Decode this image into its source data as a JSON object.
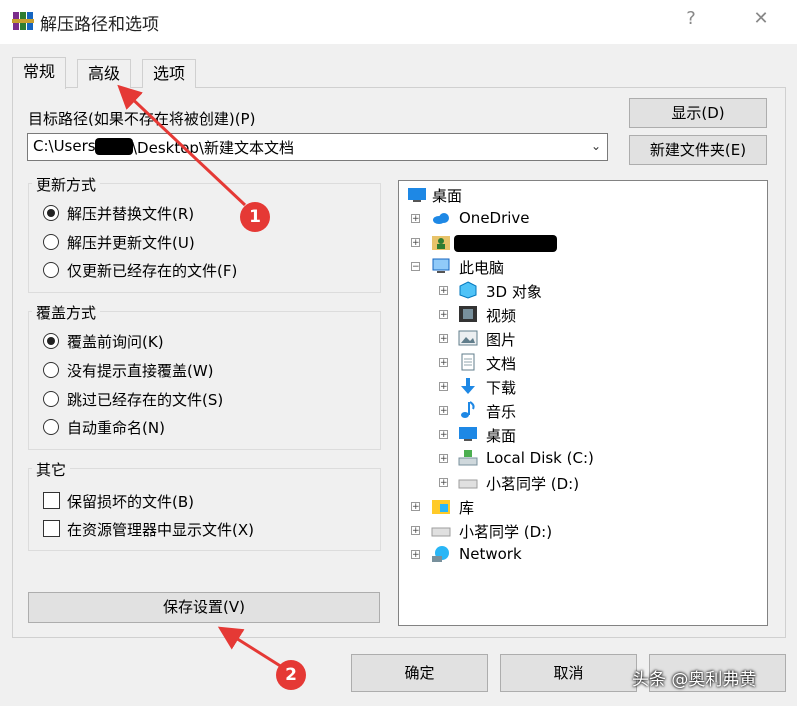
{
  "window": {
    "title": "解压路径和选项",
    "help": "?",
    "close": "✕"
  },
  "tabs": [
    {
      "label": "常规"
    },
    {
      "label": "高级"
    },
    {
      "label": "选项"
    }
  ],
  "path": {
    "label": "目标路径(如果不存在将被创建)(P)",
    "value_prefix": "C:\\Users",
    "value_suffix": "\\Desktop\\新建文本文档"
  },
  "buttons": {
    "show": "显示(D)",
    "new_folder": "新建文件夹(E)",
    "save_settings": "保存设置(V)",
    "ok": "确定",
    "cancel": "取消"
  },
  "update_mode": {
    "title": "更新方式",
    "options": [
      {
        "label": "解压并替换文件(R)",
        "selected": true
      },
      {
        "label": "解压并更新文件(U)",
        "selected": false
      },
      {
        "label": "仅更新已经存在的文件(F)",
        "selected": false
      }
    ]
  },
  "overwrite_mode": {
    "title": "覆盖方式",
    "options": [
      {
        "label": "覆盖前询问(K)",
        "selected": true
      },
      {
        "label": "没有提示直接覆盖(W)",
        "selected": false
      },
      {
        "label": "跳过已经存在的文件(S)",
        "selected": false
      },
      {
        "label": "自动重命名(N)",
        "selected": false
      }
    ]
  },
  "misc": {
    "title": "其它",
    "options": [
      {
        "label": "保留损坏的文件(B)",
        "checked": false
      },
      {
        "label": "在资源管理器中显示文件(X)",
        "checked": false
      }
    ]
  },
  "tree": [
    {
      "label": "桌面",
      "icon": "desktop-icon"
    },
    {
      "label": "OneDrive",
      "icon": "cloud-icon"
    },
    {
      "label": "",
      "icon": "user-folder-icon"
    },
    {
      "label": "此电脑",
      "icon": "computer-icon"
    },
    {
      "label": "3D 对象",
      "icon": "3d-objects-icon"
    },
    {
      "label": "视频",
      "icon": "video-icon"
    },
    {
      "label": "图片",
      "icon": "pictures-icon"
    },
    {
      "label": "文档",
      "icon": "documents-icon"
    },
    {
      "label": "下载",
      "icon": "download-icon"
    },
    {
      "label": "音乐",
      "icon": "music-icon"
    },
    {
      "label": "桌面",
      "icon": "desktop-icon"
    },
    {
      "label": "Local Disk (C:)",
      "icon": "drive-c-icon"
    },
    {
      "label": "小茗同学 (D:)",
      "icon": "drive-icon"
    },
    {
      "label": "库",
      "icon": "library-icon"
    },
    {
      "label": "小茗同学 (D:)",
      "icon": "drive-icon"
    },
    {
      "label": "Network",
      "icon": "network-icon"
    }
  ],
  "annotations": [
    {
      "number": "1"
    },
    {
      "number": "2"
    }
  ],
  "watermark": "头条 @奥利弗黄",
  "colors": {
    "annotation": "#e53935",
    "tree_bg": "#ffffff",
    "window_bg": "#f0f0f0"
  }
}
